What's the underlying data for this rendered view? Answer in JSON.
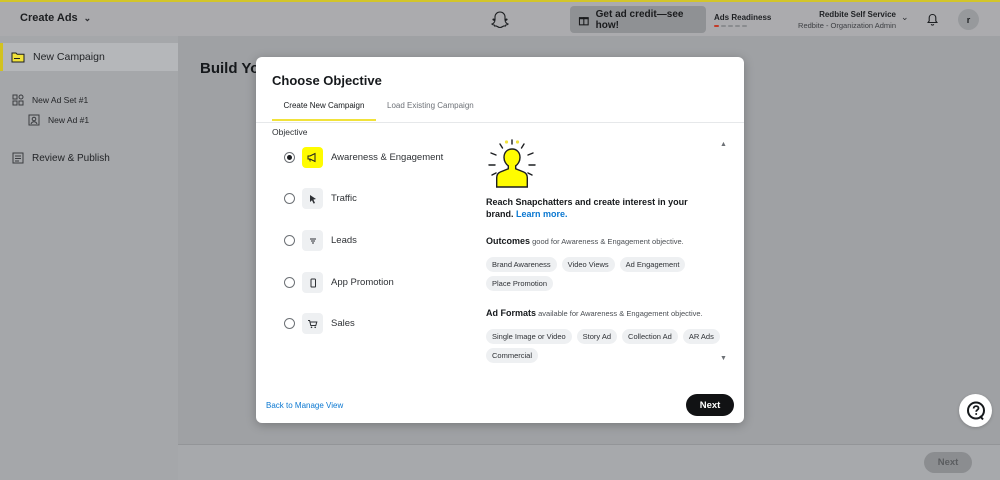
{
  "header": {
    "app_title": "Create Ads",
    "credit_button": "Get ad credit—see how!",
    "ads_readiness": "Ads Readiness",
    "org_name": "Redbite Self Service",
    "org_role": "Redbite - Organization Admin",
    "avatar_initial": "r"
  },
  "sidebar": {
    "items": [
      {
        "label": "New Campaign"
      },
      {
        "label": "New Ad Set #1"
      },
      {
        "label": "New Ad #1"
      },
      {
        "label": "Review & Publish"
      }
    ]
  },
  "main": {
    "title": "Build Yo",
    "footer_next": "Next"
  },
  "modal": {
    "title": "Choose Objective",
    "tabs": [
      "Create New Campaign",
      "Load Existing Campaign"
    ],
    "section_label": "Objective",
    "objectives": [
      {
        "label": "Awareness & Engagement",
        "icon": "megaphone-icon",
        "selected": true
      },
      {
        "label": "Traffic",
        "icon": "cursor-icon",
        "selected": false
      },
      {
        "label": "Leads",
        "icon": "filter-icon",
        "selected": false
      },
      {
        "label": "App Promotion",
        "icon": "phone-icon",
        "selected": false
      },
      {
        "label": "Sales",
        "icon": "cart-icon",
        "selected": false
      }
    ],
    "detail": {
      "headline": "Reach Snapchatters and create interest in your brand.",
      "learn_more": "Learn more.",
      "outcomes_title": "Outcomes",
      "outcomes_desc": "good for Awareness & Engagement objective.",
      "outcomes_chips": [
        "Brand Awareness",
        "Video Views",
        "Ad Engagement",
        "Place Promotion"
      ],
      "formats_title": "Ad Formats",
      "formats_desc": "available for Awareness & Engagement objective.",
      "formats_chips": [
        "Single Image or Video",
        "Story Ad",
        "Collection Ad",
        "AR Ads",
        "Commercial"
      ]
    },
    "back_link": "Back to Manage View",
    "next_label": "Next"
  },
  "colors": {
    "accent_yellow": "#fffc00",
    "link_blue": "#0b78d1",
    "dark_button": "#111214"
  }
}
